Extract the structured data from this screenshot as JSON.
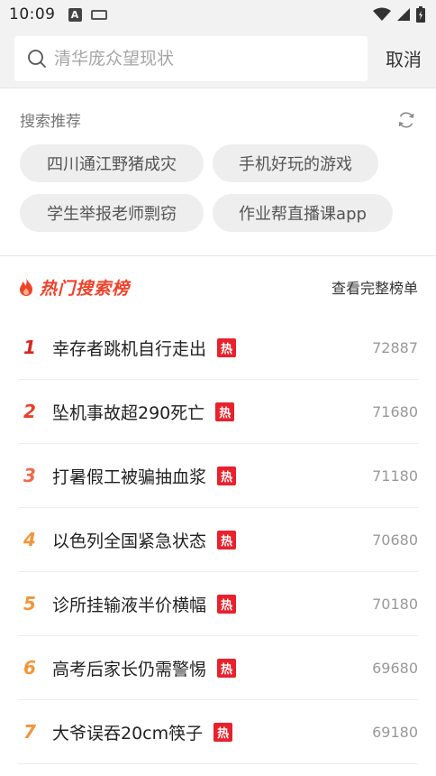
{
  "status": {
    "time": "10:09",
    "a_icon": "A"
  },
  "search": {
    "placeholder": "清华庞众望现状",
    "cancel": "取消"
  },
  "recommend": {
    "title": "搜索推荐",
    "chips": [
      "四川通江野猪成灾",
      "手机好玩的游戏",
      "学生举报老师剽窃",
      "作业帮直播课app"
    ]
  },
  "hot": {
    "title": "热门搜索榜",
    "view_all": "查看完整榜单",
    "badge": "热",
    "items": [
      {
        "rank": "1",
        "title": "幸存者跳机自行走出",
        "count": "72887",
        "color": "#d9251d"
      },
      {
        "rank": "2",
        "title": "坠机事故超290死亡",
        "count": "71680",
        "color": "#e8412b"
      },
      {
        "rank": "3",
        "title": "打暑假工被骗抽血浆",
        "count": "71180",
        "color": "#ef6a4c"
      },
      {
        "rank": "4",
        "title": "以色列全国紧急状态",
        "count": "70680",
        "color": "#f2953a"
      },
      {
        "rank": "5",
        "title": "诊所挂输液半价横幅",
        "count": "70180",
        "color": "#f2953a"
      },
      {
        "rank": "6",
        "title": "高考后家长仍需警惕",
        "count": "69680",
        "color": "#f2953a"
      },
      {
        "rank": "7",
        "title": "大爷误吞20cm筷子",
        "count": "69180",
        "color": "#f2953a"
      }
    ]
  }
}
